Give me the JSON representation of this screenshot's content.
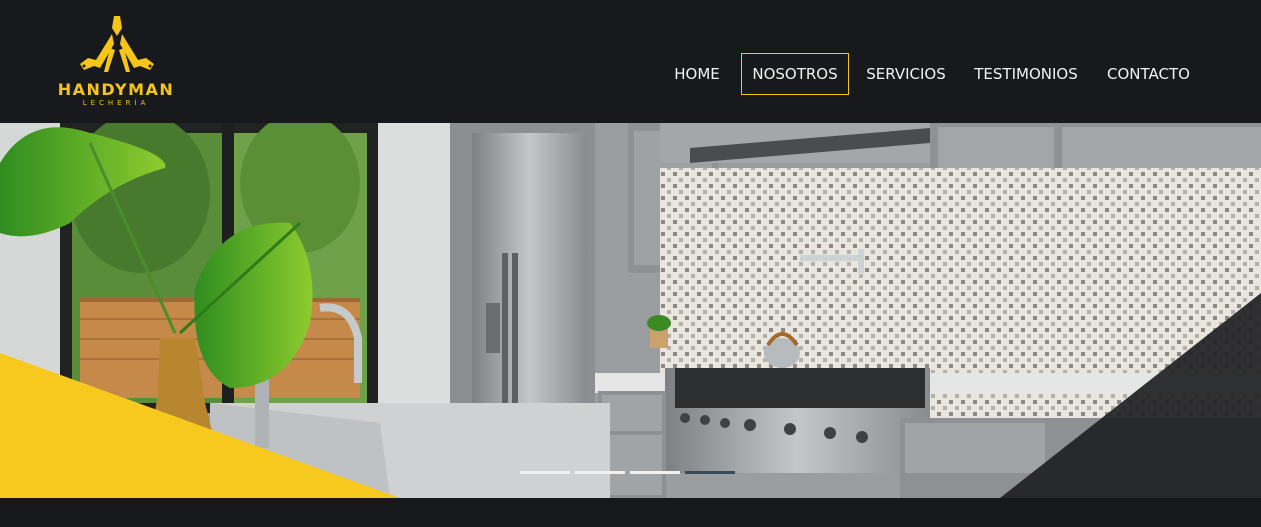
{
  "brand": {
    "name": "HANDYMAN",
    "tagline": "LECHERÍA",
    "color": "#f5c518"
  },
  "nav": {
    "items": [
      {
        "label": "HOME",
        "active": false
      },
      {
        "label": "NOSOTROS",
        "active": true
      },
      {
        "label": "SERVICIOS",
        "active": false
      },
      {
        "label": "TESTIMONIOS",
        "active": false
      },
      {
        "label": "CONTACTO",
        "active": false
      }
    ]
  },
  "hero": {
    "image": "kitchen-photo",
    "slides_total": 4,
    "active_slide": 4
  },
  "colors": {
    "header_bg": "#18191c",
    "accent": "#f5c518",
    "dark_overlay": "#202226"
  }
}
